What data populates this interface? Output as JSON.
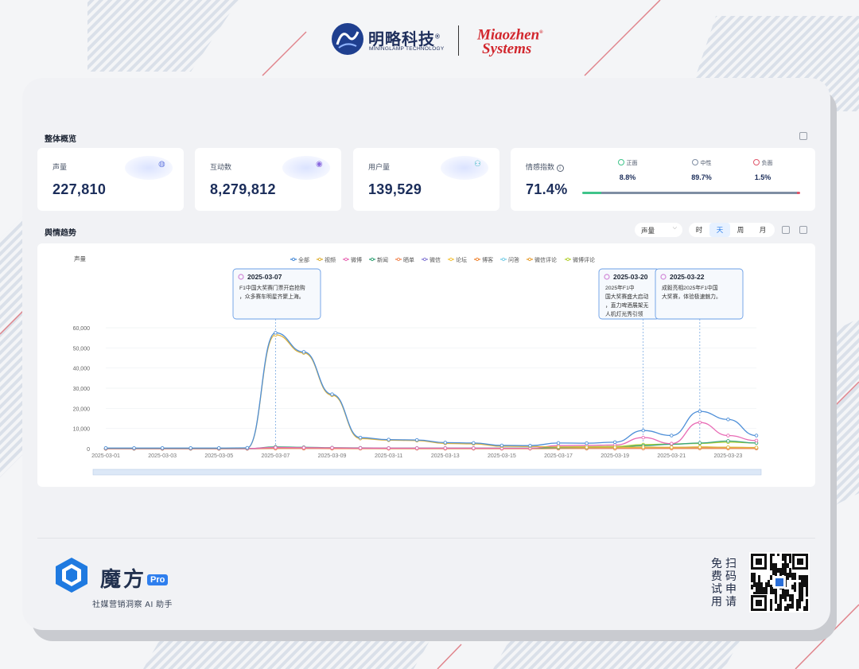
{
  "brand": {
    "company_name": "明略科技",
    "company_reg": "®",
    "company_sub": "MININGLAMP TECHNOLOGY",
    "partner_line1": "Miaozhen",
    "partner_line2": "Systems",
    "partner_reg": "®"
  },
  "overview": {
    "title": "整体概览",
    "stats": [
      {
        "label": "声量",
        "value": "227,810"
      },
      {
        "label": "互动数",
        "value": "8,279,812"
      },
      {
        "label": "用户量",
        "value": "139,529"
      }
    ],
    "sentiment": {
      "label": "情感指数",
      "value": "71.4%",
      "items": [
        {
          "label": "正面",
          "pct": "8.8%",
          "color": "#3fc48a",
          "share": 0.088
        },
        {
          "label": "中性",
          "pct": "89.7%",
          "color": "#7f8ea3",
          "share": 0.897
        },
        {
          "label": "负面",
          "pct": "1.5%",
          "color": "#e0566a",
          "share": 0.015
        }
      ]
    }
  },
  "trend": {
    "title": "舆情趋势",
    "metric_select": "声量",
    "granularity": [
      "时",
      "天",
      "周",
      "月"
    ],
    "granularity_active": "天"
  },
  "chart_data": {
    "type": "line",
    "ylabel": "声量",
    "ylim": [
      0,
      60000
    ],
    "yticks": [
      "60,000",
      "50,000",
      "40,000",
      "30,000",
      "20,000",
      "10,000",
      "0"
    ],
    "x": [
      "2025-03-01",
      "2025-03-02",
      "2025-03-03",
      "2025-03-04",
      "2025-03-05",
      "2025-03-06",
      "2025-03-07",
      "2025-03-08",
      "2025-03-09",
      "2025-03-10",
      "2025-03-11",
      "2025-03-12",
      "2025-03-13",
      "2025-03-14",
      "2025-03-15",
      "2025-03-16",
      "2025-03-17",
      "2025-03-18",
      "2025-03-19",
      "2025-03-20",
      "2025-03-21",
      "2025-03-22",
      "2025-03-23",
      "2025-03-24"
    ],
    "xticks": [
      "2025-03-01",
      "2025-03-03",
      "2025-03-05",
      "2025-03-07",
      "2025-03-09",
      "2025-03-11",
      "2025-03-13",
      "2025-03-15",
      "2025-03-17",
      "2025-03-19",
      "2025-03-21",
      "2025-03-23"
    ],
    "legend": [
      "全部",
      "视频",
      "微博",
      "新闻",
      "晒单",
      "微信",
      "论坛",
      "博客",
      "问答",
      "微信评论",
      "微博评论"
    ],
    "series": [
      {
        "name": "全部",
        "color": "#4e8fd8",
        "values": [
          300,
          300,
          300,
          300,
          300,
          400,
          57500,
          48000,
          27000,
          5500,
          4500,
          4300,
          3000,
          2800,
          1600,
          1500,
          2800,
          2700,
          3200,
          9000,
          6500,
          18500,
          14500,
          6500
        ]
      },
      {
        "name": "视频",
        "color": "#e0b33c",
        "values": [
          200,
          200,
          200,
          200,
          200,
          300,
          56500,
          47500,
          26500,
          5000,
          4200,
          4000,
          2600,
          2400,
          1200,
          1100,
          800,
          700,
          700,
          800,
          700,
          800,
          700,
          600
        ]
      },
      {
        "name": "微博",
        "color": "#e86bb5",
        "values": [
          50,
          50,
          50,
          50,
          50,
          50,
          600,
          500,
          400,
          300,
          250,
          250,
          250,
          250,
          200,
          200,
          1500,
          1600,
          1800,
          5500,
          2500,
          13000,
          6500,
          4000
        ]
      },
      {
        "name": "新闻",
        "color": "#3aa57a",
        "values": [
          20,
          20,
          20,
          20,
          20,
          20,
          900,
          700,
          500,
          400,
          300,
          300,
          300,
          300,
          300,
          300,
          500,
          600,
          700,
          1500,
          2200,
          2800,
          3800,
          2800
        ]
      },
      {
        "name": "晒单",
        "color": "#f28c5a",
        "values": [
          0,
          0,
          0,
          0,
          0,
          0,
          100,
          100,
          80,
          60,
          50,
          50,
          50,
          50,
          40,
          40,
          80,
          80,
          90,
          150,
          200,
          300,
          250,
          200
        ]
      },
      {
        "name": "微信",
        "color": "#8a7fd6",
        "values": [
          0,
          0,
          0,
          0,
          0,
          0,
          150,
          120,
          100,
          80,
          60,
          60,
          60,
          50,
          50,
          50,
          100,
          100,
          120,
          200,
          250,
          350,
          300,
          250
        ]
      },
      {
        "name": "论坛",
        "color": "#f5c542",
        "values": [
          10,
          10,
          10,
          10,
          10,
          10,
          200,
          150,
          120,
          100,
          80,
          80,
          80,
          70,
          60,
          60,
          150,
          180,
          200,
          400,
          600,
          900,
          700,
          500
        ]
      },
      {
        "name": "博客",
        "color": "#f08a3c",
        "values": [
          0,
          0,
          0,
          0,
          0,
          0,
          50,
          40,
          30,
          30,
          20,
          20,
          20,
          20,
          20,
          20,
          40,
          40,
          50,
          80,
          100,
          120,
          100,
          80
        ]
      },
      {
        "name": "问答",
        "color": "#7fd1e8",
        "values": [
          0,
          0,
          0,
          0,
          0,
          0,
          60,
          50,
          40,
          30,
          30,
          30,
          30,
          30,
          20,
          20,
          40,
          40,
          50,
          90,
          120,
          150,
          120,
          100
        ]
      },
      {
        "name": "微信评论",
        "color": "#e8a23a",
        "values": [
          0,
          0,
          0,
          0,
          0,
          0,
          80,
          70,
          60,
          40,
          30,
          30,
          30,
          30,
          30,
          30,
          60,
          60,
          70,
          120,
          150,
          200,
          160,
          130
        ]
      },
      {
        "name": "微博评论",
        "color": "#b7d23a",
        "values": [
          0,
          0,
          0,
          0,
          0,
          0,
          300,
          250,
          200,
          150,
          120,
          120,
          120,
          100,
          100,
          100,
          900,
          1000,
          1100,
          2000,
          2300,
          2600,
          3200,
          2800
        ]
      }
    ],
    "annotations": [
      {
        "date": "2025-03-07",
        "index": 6,
        "text": "F1中国大奖赛门票开启抢购，众多赛车明星齐聚上海。"
      },
      {
        "date": "2025-03-20",
        "index": 19,
        "text": "2025年F1中国大奖赛盛大启动，直力啤酒展架无人机灯光秀引领"
      },
      {
        "date": "2025-03-22",
        "index": 21,
        "text": "成毅亮相2025年F1中国大奖赛，体验极速魅力。"
      }
    ]
  },
  "footer": {
    "product_name": "魔方",
    "product_badge": "Pro",
    "tagline": "社媒营销洞察 AI 助手",
    "cta_col1": "免费试用",
    "cta_col2": "扫码申请"
  }
}
